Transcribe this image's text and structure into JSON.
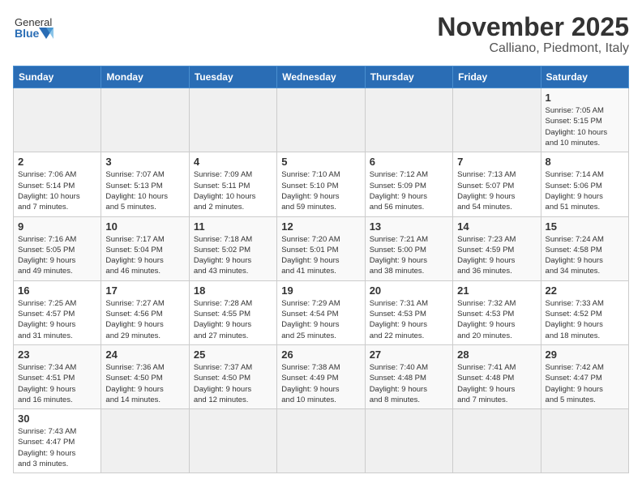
{
  "header": {
    "logo_text_normal": "General",
    "logo_text_bold": "Blue",
    "month": "November 2025",
    "location": "Calliano, Piedmont, Italy"
  },
  "weekdays": [
    "Sunday",
    "Monday",
    "Tuesday",
    "Wednesday",
    "Thursday",
    "Friday",
    "Saturday"
  ],
  "weeks": [
    [
      {
        "day": "",
        "info": ""
      },
      {
        "day": "",
        "info": ""
      },
      {
        "day": "",
        "info": ""
      },
      {
        "day": "",
        "info": ""
      },
      {
        "day": "",
        "info": ""
      },
      {
        "day": "",
        "info": ""
      },
      {
        "day": "1",
        "info": "Sunrise: 7:05 AM\nSunset: 5:15 PM\nDaylight: 10 hours\nand 10 minutes."
      }
    ],
    [
      {
        "day": "2",
        "info": "Sunrise: 7:06 AM\nSunset: 5:14 PM\nDaylight: 10 hours\nand 7 minutes."
      },
      {
        "day": "3",
        "info": "Sunrise: 7:07 AM\nSunset: 5:13 PM\nDaylight: 10 hours\nand 5 minutes."
      },
      {
        "day": "4",
        "info": "Sunrise: 7:09 AM\nSunset: 5:11 PM\nDaylight: 10 hours\nand 2 minutes."
      },
      {
        "day": "5",
        "info": "Sunrise: 7:10 AM\nSunset: 5:10 PM\nDaylight: 9 hours\nand 59 minutes."
      },
      {
        "day": "6",
        "info": "Sunrise: 7:12 AM\nSunset: 5:09 PM\nDaylight: 9 hours\nand 56 minutes."
      },
      {
        "day": "7",
        "info": "Sunrise: 7:13 AM\nSunset: 5:07 PM\nDaylight: 9 hours\nand 54 minutes."
      },
      {
        "day": "8",
        "info": "Sunrise: 7:14 AM\nSunset: 5:06 PM\nDaylight: 9 hours\nand 51 minutes."
      }
    ],
    [
      {
        "day": "9",
        "info": "Sunrise: 7:16 AM\nSunset: 5:05 PM\nDaylight: 9 hours\nand 49 minutes."
      },
      {
        "day": "10",
        "info": "Sunrise: 7:17 AM\nSunset: 5:04 PM\nDaylight: 9 hours\nand 46 minutes."
      },
      {
        "day": "11",
        "info": "Sunrise: 7:18 AM\nSunset: 5:02 PM\nDaylight: 9 hours\nand 43 minutes."
      },
      {
        "day": "12",
        "info": "Sunrise: 7:20 AM\nSunset: 5:01 PM\nDaylight: 9 hours\nand 41 minutes."
      },
      {
        "day": "13",
        "info": "Sunrise: 7:21 AM\nSunset: 5:00 PM\nDaylight: 9 hours\nand 38 minutes."
      },
      {
        "day": "14",
        "info": "Sunrise: 7:23 AM\nSunset: 4:59 PM\nDaylight: 9 hours\nand 36 minutes."
      },
      {
        "day": "15",
        "info": "Sunrise: 7:24 AM\nSunset: 4:58 PM\nDaylight: 9 hours\nand 34 minutes."
      }
    ],
    [
      {
        "day": "16",
        "info": "Sunrise: 7:25 AM\nSunset: 4:57 PM\nDaylight: 9 hours\nand 31 minutes."
      },
      {
        "day": "17",
        "info": "Sunrise: 7:27 AM\nSunset: 4:56 PM\nDaylight: 9 hours\nand 29 minutes."
      },
      {
        "day": "18",
        "info": "Sunrise: 7:28 AM\nSunset: 4:55 PM\nDaylight: 9 hours\nand 27 minutes."
      },
      {
        "day": "19",
        "info": "Sunrise: 7:29 AM\nSunset: 4:54 PM\nDaylight: 9 hours\nand 25 minutes."
      },
      {
        "day": "20",
        "info": "Sunrise: 7:31 AM\nSunset: 4:53 PM\nDaylight: 9 hours\nand 22 minutes."
      },
      {
        "day": "21",
        "info": "Sunrise: 7:32 AM\nSunset: 4:53 PM\nDaylight: 9 hours\nand 20 minutes."
      },
      {
        "day": "22",
        "info": "Sunrise: 7:33 AM\nSunset: 4:52 PM\nDaylight: 9 hours\nand 18 minutes."
      }
    ],
    [
      {
        "day": "23",
        "info": "Sunrise: 7:34 AM\nSunset: 4:51 PM\nDaylight: 9 hours\nand 16 minutes."
      },
      {
        "day": "24",
        "info": "Sunrise: 7:36 AM\nSunset: 4:50 PM\nDaylight: 9 hours\nand 14 minutes."
      },
      {
        "day": "25",
        "info": "Sunrise: 7:37 AM\nSunset: 4:50 PM\nDaylight: 9 hours\nand 12 minutes."
      },
      {
        "day": "26",
        "info": "Sunrise: 7:38 AM\nSunset: 4:49 PM\nDaylight: 9 hours\nand 10 minutes."
      },
      {
        "day": "27",
        "info": "Sunrise: 7:40 AM\nSunset: 4:48 PM\nDaylight: 9 hours\nand 8 minutes."
      },
      {
        "day": "28",
        "info": "Sunrise: 7:41 AM\nSunset: 4:48 PM\nDaylight: 9 hours\nand 7 minutes."
      },
      {
        "day": "29",
        "info": "Sunrise: 7:42 AM\nSunset: 4:47 PM\nDaylight: 9 hours\nand 5 minutes."
      }
    ],
    [
      {
        "day": "30",
        "info": "Sunrise: 7:43 AM\nSunset: 4:47 PM\nDaylight: 9 hours\nand 3 minutes."
      },
      {
        "day": "",
        "info": ""
      },
      {
        "day": "",
        "info": ""
      },
      {
        "day": "",
        "info": ""
      },
      {
        "day": "",
        "info": ""
      },
      {
        "day": "",
        "info": ""
      },
      {
        "day": "",
        "info": ""
      }
    ]
  ]
}
